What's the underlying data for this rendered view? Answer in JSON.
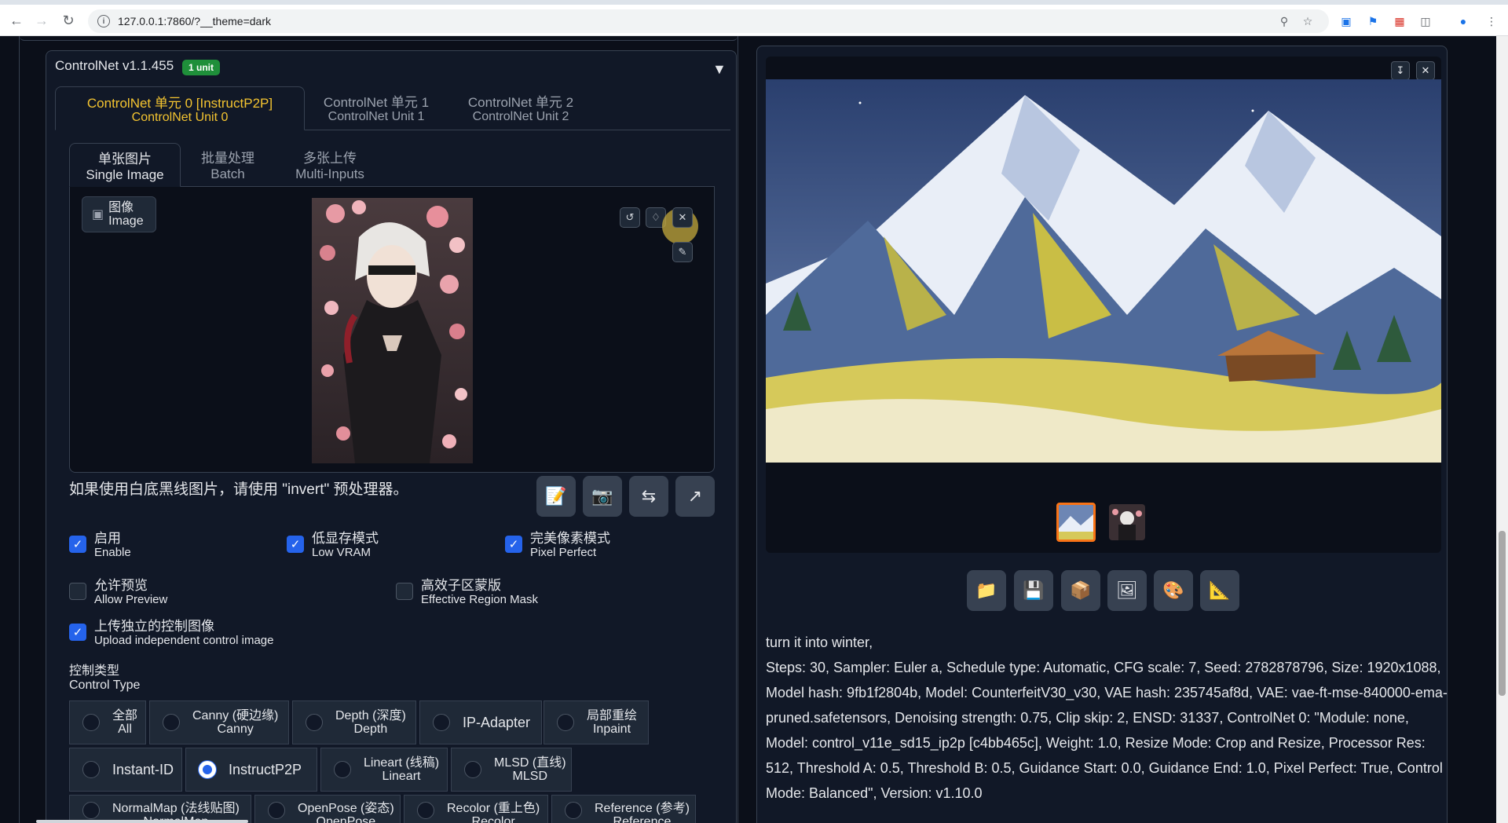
{
  "browser": {
    "url": "127.0.0.1:7860/?__theme=dark"
  },
  "controlnet": {
    "title": "ControlNet v1.1.455",
    "badge": "1 unit",
    "unit_tabs": [
      {
        "l1": "ControlNet 单元 0 [InstructP2P]",
        "l2": "ControlNet Unit 0"
      },
      {
        "l1": "ControlNet 单元 1",
        "l2": "ControlNet Unit 1"
      },
      {
        "l1": "ControlNet 单元 2",
        "l2": "ControlNet Unit 2"
      }
    ],
    "image_tabs": [
      {
        "l1": "单张图片",
        "l2": "Single Image"
      },
      {
        "l1": "批量处理",
        "l2": "Batch"
      },
      {
        "l1": "多张上传",
        "l2": "Multi-Inputs"
      }
    ],
    "image_label": {
      "l1": "图像",
      "l2": "Image"
    },
    "hint": "如果使用白底黑线图片，请使用 \"invert\" 预处理器。",
    "checkboxes": [
      {
        "l1": "启用",
        "l2": "Enable",
        "checked": true
      },
      {
        "l1": "低显存模式",
        "l2": "Low VRAM",
        "checked": true
      },
      {
        "l1": "完美像素模式",
        "l2": "Pixel Perfect",
        "checked": true
      },
      {
        "l1": "允许预览",
        "l2": "Allow Preview",
        "checked": false
      },
      {
        "l1": "高效子区蒙版",
        "l2": "Effective Region Mask",
        "checked": false
      },
      {
        "l1": "上传独立的控制图像",
        "l2": "Upload independent control image",
        "checked": true
      }
    ],
    "control_type": {
      "l1": "控制类型",
      "l2": "Control Type",
      "options": [
        {
          "l1": "全部",
          "l2": "All"
        },
        {
          "l1": "Canny (硬边缘)",
          "l2": "Canny"
        },
        {
          "l1": "Depth (深度)",
          "l2": "Depth"
        },
        {
          "l1": "IP-Adapter",
          "l2": ""
        },
        {
          "l1": "局部重绘",
          "l2": "Inpaint"
        },
        {
          "l1": "Instant-ID",
          "l2": ""
        },
        {
          "l1": "InstructP2P",
          "l2": ""
        },
        {
          "l1": "Lineart (线稿)",
          "l2": "Lineart"
        },
        {
          "l1": "MLSD (直线)",
          "l2": "MLSD"
        },
        {
          "l1": "NormalMap (法线贴图)",
          "l2": "NormalMap"
        },
        {
          "l1": "OpenPose (姿态)",
          "l2": "OpenPose"
        },
        {
          "l1": "Recolor (重上色)",
          "l2": "Recolor"
        },
        {
          "l1": "Reference (参考)",
          "l2": "Reference"
        }
      ],
      "selected": "InstructP2P"
    }
  },
  "output": {
    "prompt": "turn it into winter,",
    "params": "Steps: 30, Sampler: Euler a, Schedule type: Automatic, CFG scale: 7, Seed: 2782878796, Size: 1920x1088, Model hash: 9fb1f2804b, Model: CounterfeitV30_v30, VAE hash: 235745af8d, VAE: vae-ft-mse-840000-ema-pruned.safetensors, Denoising strength: 0.75, Clip skip: 2, ENSD: 31337, ControlNet 0: \"Module: none, Model: control_v11e_sd15_ip2p [c4bb465c], Weight: 1.0, Resize Mode: Crop and Resize, Processor Res: 512, Threshold A: 0.5, Threshold B: 0.5, Guidance Start: 0.0, Guidance End: 1.0, Pixel Perfect: True, Control Mode: Balanced\", Version: v1.10.0"
  }
}
